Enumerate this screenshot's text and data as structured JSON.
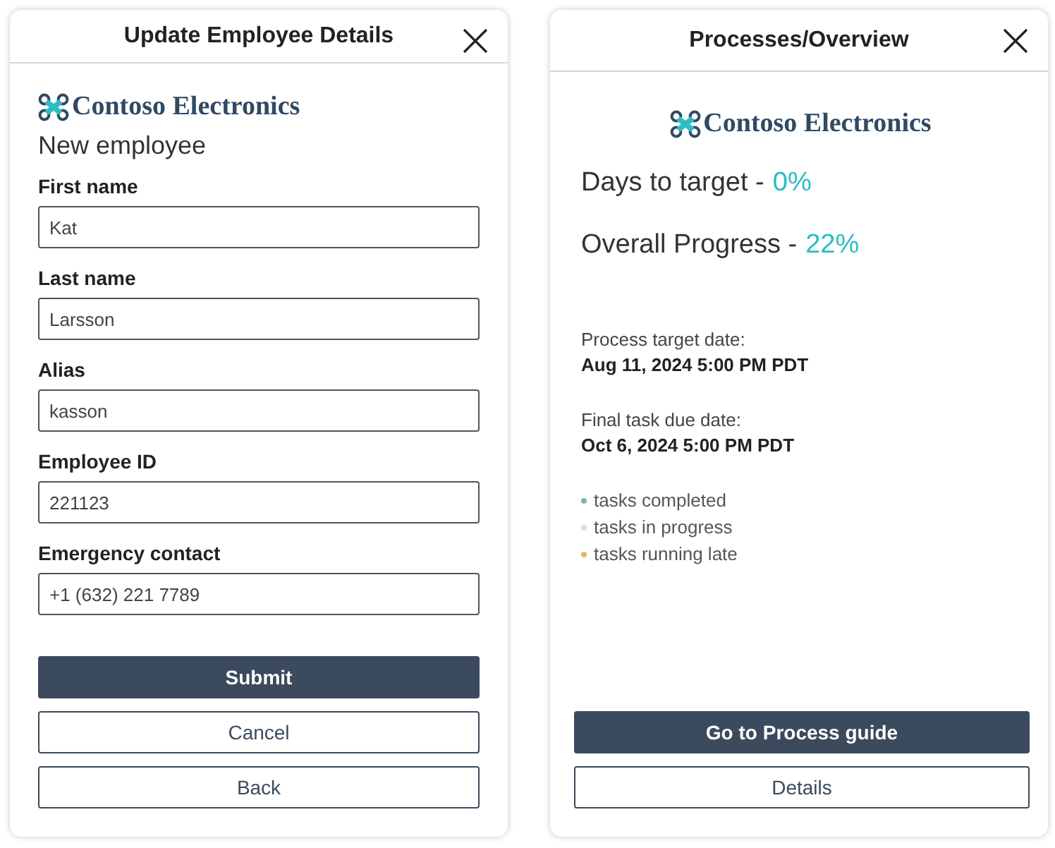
{
  "employee_dialog": {
    "title": "Update Employee Details",
    "brand": "Contoso Electronics",
    "heading": "New employee",
    "fields": [
      {
        "label": "First name",
        "value": "Kat"
      },
      {
        "label": "Last name",
        "value": "Larsson"
      },
      {
        "label": "Alias",
        "value": "kasson"
      },
      {
        "label": "Employee ID",
        "value": "221123"
      },
      {
        "label": "Emergency contact",
        "value": "+1 (632) 221 7789"
      }
    ],
    "buttons": [
      {
        "label": "Submit",
        "kind": "primary"
      },
      {
        "label": "Cancel",
        "kind": "secondary"
      },
      {
        "label": "Back",
        "kind": "secondary"
      }
    ]
  },
  "overview_dialog": {
    "title": "Processes/Overview",
    "brand": "Contoso Electronics",
    "metrics": [
      {
        "label": "Days to target -",
        "value": "0%"
      },
      {
        "label": "Overall Progress -",
        "value": "22%"
      }
    ],
    "dates": [
      {
        "label": "Process target date:",
        "value": "Aug 11, 2024 5:00 PM PDT"
      },
      {
        "label": "Final task due date:",
        "value": "Oct 6, 2024 5:00 PM PDT"
      }
    ],
    "legend": [
      {
        "label": "tasks completed",
        "color": "#7fb8a0"
      },
      {
        "label": "tasks in progress",
        "color": "#cde3dc"
      },
      {
        "label": "tasks running late",
        "color": "#e8b46a"
      }
    ],
    "buttons": [
      {
        "label": "Go to Process guide",
        "kind": "primary"
      },
      {
        "label": "Details",
        "kind": "secondary"
      }
    ]
  }
}
